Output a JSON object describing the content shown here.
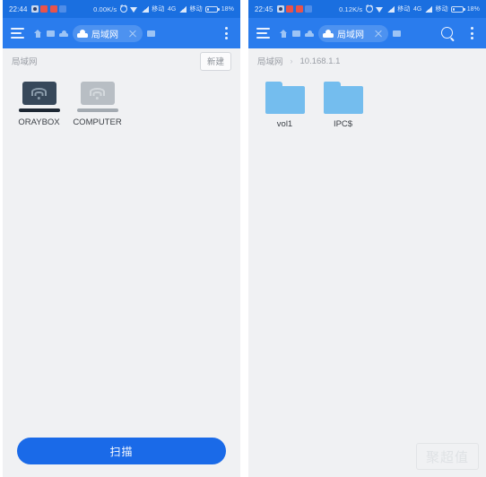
{
  "app": {
    "accent_blue": "#2a7ced",
    "status_blue": "#1a6fe0",
    "page_bg": "#f0f1f3",
    "button_blue": "#1a6ae8",
    "folder_blue": "#74bdee"
  },
  "left": {
    "statusbar": {
      "time": "22:44",
      "net_speed": "0.00K/s",
      "carrier1": "移动",
      "network_type": "4G",
      "carrier2": "移动",
      "battery": "18%",
      "icons": [
        "app-badge-icon",
        "red-badge-icon",
        "red-badge-icon",
        "blue-badge-icon",
        "alarm-icon",
        "wifi-icon",
        "signal-icon",
        "signal-icon",
        "battery-icon"
      ]
    },
    "appbar": {
      "menu_icon": "hamburger-icon",
      "home_icon": "home-icon",
      "tile_icon": "tile-icon",
      "cloud_icon": "cloud-icon",
      "tab_label": "局域网",
      "close_icon": "close-icon",
      "overflow_icon": "kebab-menu-icon"
    },
    "breadcrumb": {
      "path": "局域网",
      "new_button": "新建"
    },
    "items": [
      {
        "label": "ORAYBOX",
        "icon": "laptop-wifi-icon",
        "state": "active"
      },
      {
        "label": "COMPUTER",
        "icon": "laptop-wifi-icon",
        "state": "inactive"
      }
    ],
    "action": {
      "scan_label": "扫描"
    }
  },
  "right": {
    "statusbar": {
      "time": "22:45",
      "net_speed": "0.12K/s",
      "carrier1": "移动",
      "network_type": "4G",
      "carrier2": "移动",
      "battery": "18%"
    },
    "appbar": {
      "menu_icon": "hamburger-icon",
      "home_icon": "home-icon",
      "tile_icon": "tile-icon",
      "cloud_icon": "cloud-icon",
      "tab_label": "局域网",
      "close_icon": "close-icon",
      "search_icon": "search-icon",
      "overflow_icon": "kebab-menu-icon"
    },
    "breadcrumb": {
      "root": "局域网",
      "separator": "›",
      "current": "10.168.1.1"
    },
    "items": [
      {
        "label": "vol1",
        "icon": "folder-icon"
      },
      {
        "label": "IPC$",
        "icon": "folder-icon"
      }
    ],
    "watermark": "聚超值"
  }
}
